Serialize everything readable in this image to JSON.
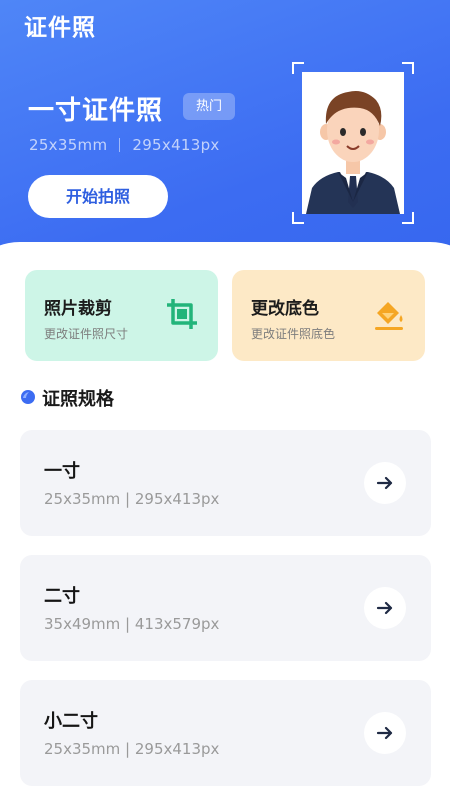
{
  "app": {
    "title": "证件照"
  },
  "hero": {
    "size_title": "一寸证件照",
    "badge": "热门",
    "spec_mm": "25x35mm",
    "spec_px": "295x413px",
    "start_button": "开始拍照"
  },
  "tools": [
    {
      "title": "照片裁剪",
      "subtitle": "更改证件照尺寸",
      "icon": "crop-icon"
    },
    {
      "title": "更改底色",
      "subtitle": "更改证件照底色",
      "icon": "paint-bucket-icon"
    }
  ],
  "section": {
    "title": "证照规格"
  },
  "specs": [
    {
      "name": "一寸",
      "size": "25x35mm  |  295x413px"
    },
    {
      "name": "二寸",
      "size": "35x49mm  |  413x579px"
    },
    {
      "name": "小二寸",
      "size": "25x35mm  |  295x413px"
    }
  ],
  "colors": {
    "primary": "#3c6cf2",
    "crop_card": "#cdf5e7",
    "bg_card": "#fde9c6",
    "crop_icon": "#22b47a",
    "bg_icon": "#f5a623"
  }
}
